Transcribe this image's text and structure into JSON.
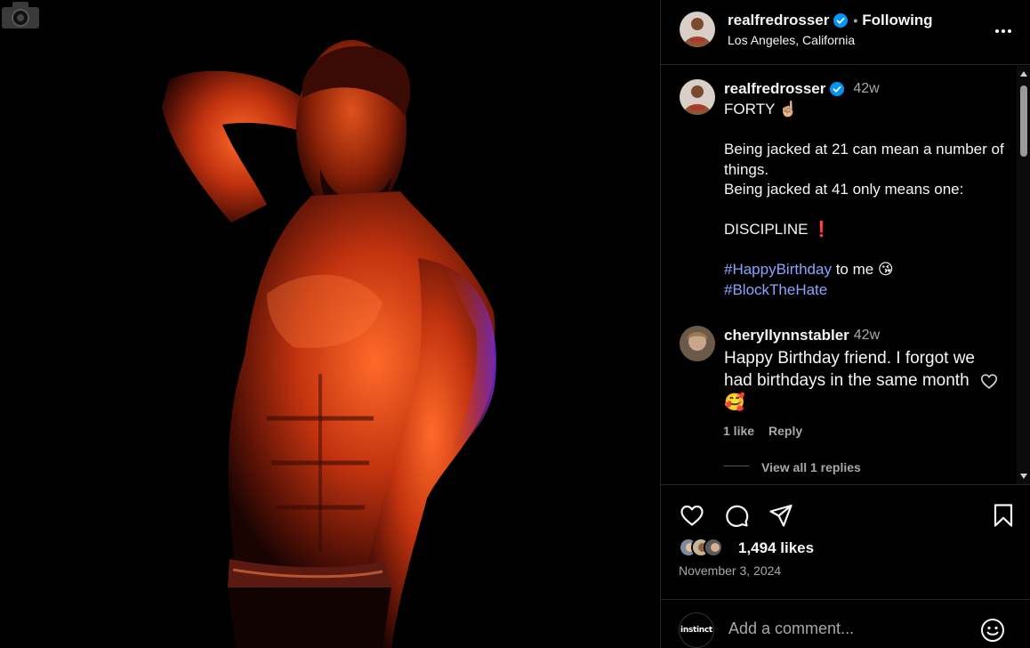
{
  "post": {
    "username": "realfredrosser",
    "separator": "•",
    "follow_label": "Following",
    "location": "Los Angeles, California"
  },
  "caption": {
    "username": "realfredrosser",
    "time": "42w",
    "line1": "FORTY ☝🏼",
    "line2": "Being jacked at 21 can mean a number of things.",
    "line3": "Being jacked at 41 only means one:",
    "line4": "DISCIPLINE ❗",
    "hashtag1": "#HappyBirthday",
    "hashtag1_tail": " to me 😘",
    "hashtag2": "#BlockTheHate"
  },
  "comment": {
    "username": "cheryllynnstabler",
    "time": "42w",
    "text": "Happy Birthday friend. I forgot we had birthdays in the same month 🥰",
    "likes": "1 like",
    "reply_label": "Reply",
    "view_replies": "View all 1 replies"
  },
  "actions": {
    "likes": "1,494 likes",
    "date": "November 3, 2024",
    "comment_placeholder": "Add a comment...",
    "my_avatar_text": "instinct"
  },
  "icons": {
    "verified": "verified-badge-icon",
    "more": "more-options-icon",
    "like": "heart-icon",
    "comment": "comment-bubble-icon",
    "share": "paper-plane-icon",
    "save": "bookmark-icon",
    "emoji": "smiley-icon",
    "watermark": "camera-icon"
  },
  "colors": {
    "background": "#000000",
    "text": "#f5f5f5",
    "muted": "#a8a8a8",
    "hashtag": "#8aa4ff",
    "verified": "#0095f6"
  }
}
